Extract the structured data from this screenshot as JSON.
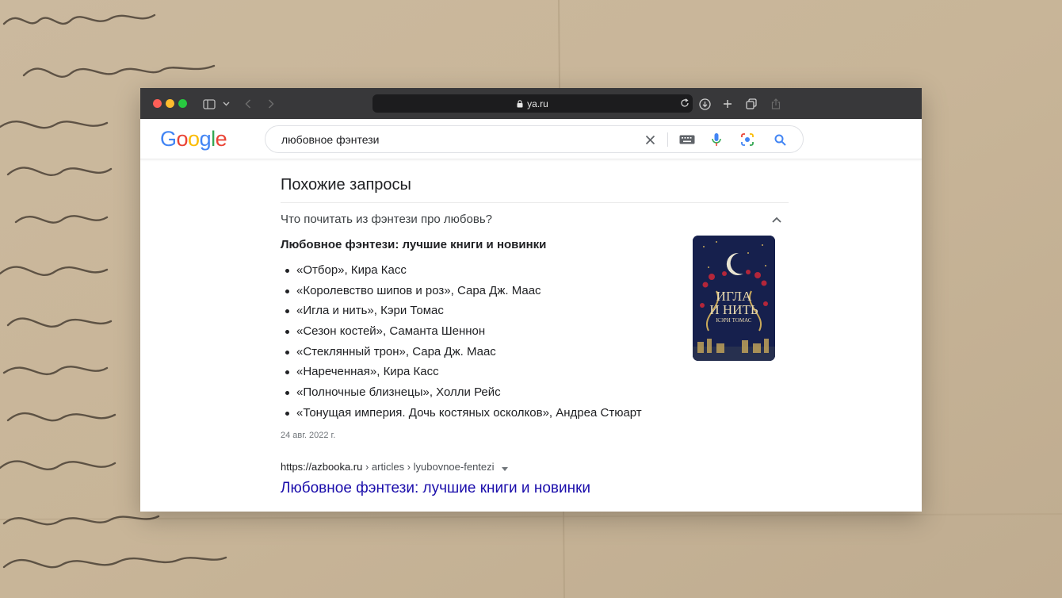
{
  "browser": {
    "url": "ya.ru"
  },
  "google": {
    "logo_text": "Google",
    "search_query": "любовное фэнтези"
  },
  "related": {
    "heading": "Похожие запросы",
    "question": "Что почитать из фэнтези про любовь?",
    "snippet_title": "Любовное фэнтези: лучшие книги и новинки",
    "books": [
      "«Отбор», Кира Касс",
      "«Королевство шипов и роз», Сара Дж. Маас",
      "«Игла и нить», Кэри Томас",
      "«Сезон костей», Саманта Шеннон",
      "«Стеклянный трон», Сара Дж. Маас",
      "«Нареченная», Кира Касс",
      "«Полночные близнецы», Холли Рейс",
      "«Тонущая империя. Дочь костяных осколков», Андреа Стюарт"
    ],
    "date": "24 авг. 2022 г.",
    "cover_title_line1": "ИГЛА",
    "cover_title_line2": "И НИТЬ",
    "cover_author": "КЭРИ ТОМАС"
  },
  "result": {
    "site": "https://azbooka.ru",
    "path": " › articles › lyubovnoe-fentezi",
    "title": "Любовное фэнтези: лучшие книги и новинки"
  },
  "colors": {
    "google_blue": "#4285F4",
    "google_red": "#EA4335",
    "google_yellow": "#FBBC05",
    "google_green": "#34A853",
    "link": "#1a0dab"
  }
}
